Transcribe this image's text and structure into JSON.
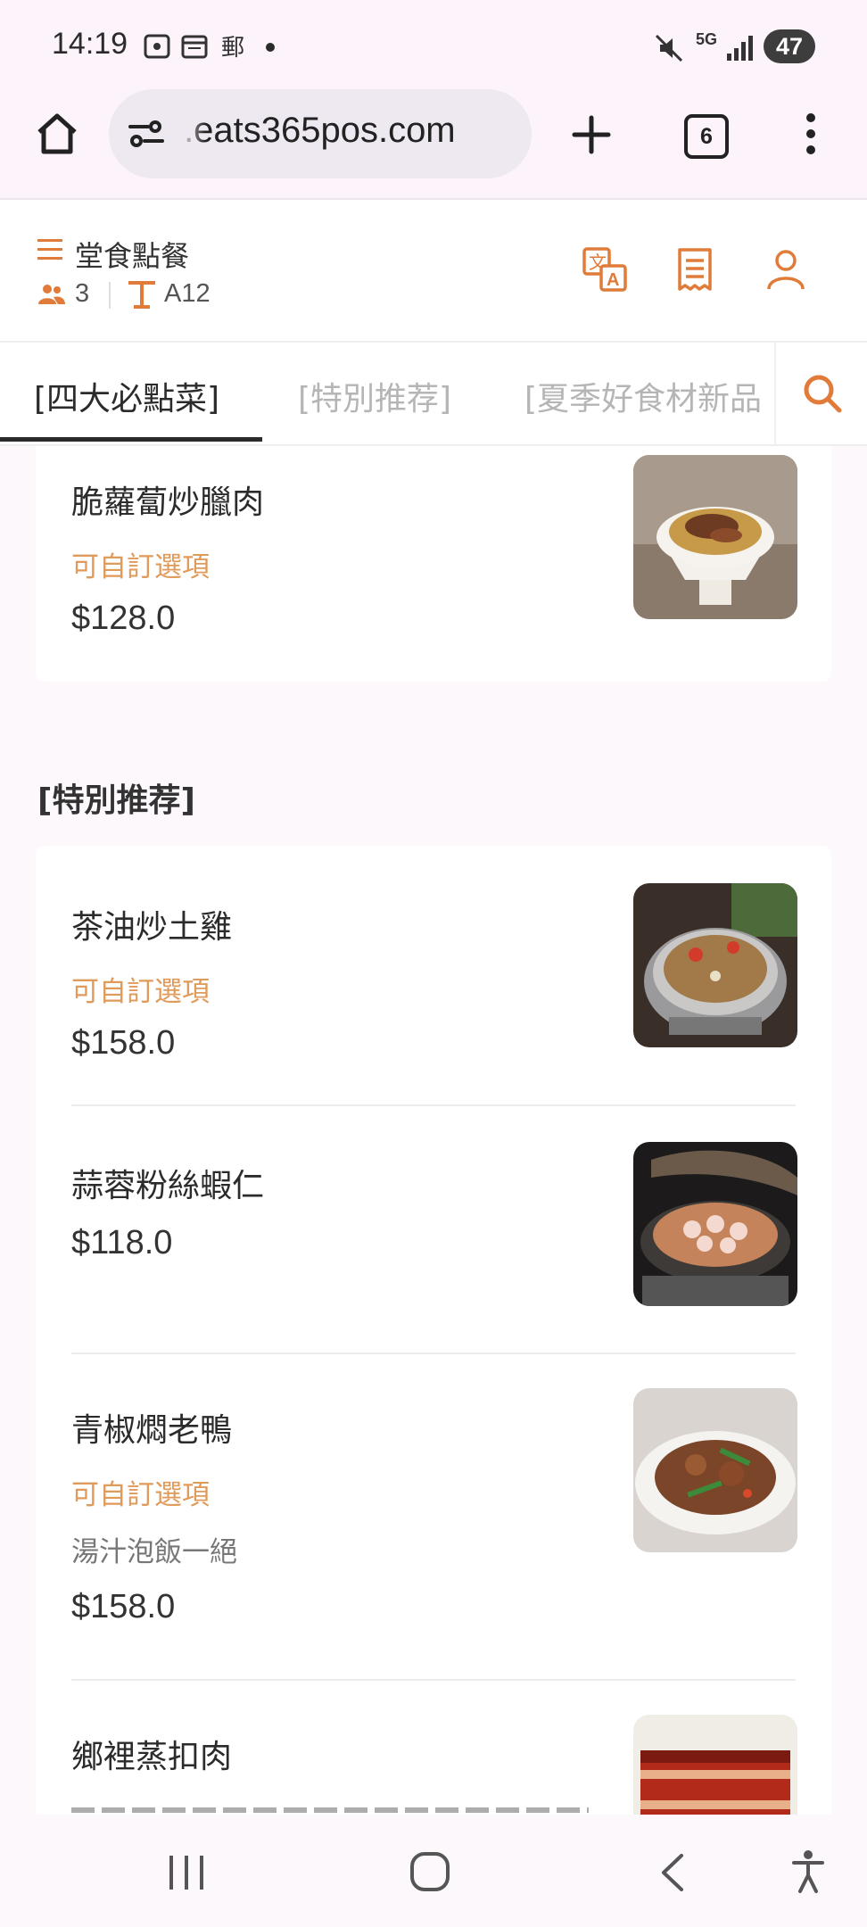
{
  "status_bar": {
    "time": "14:19",
    "network": "5G",
    "battery": "47"
  },
  "browser": {
    "url": ".eats365pos.com",
    "tab_count": "6"
  },
  "app_header": {
    "mode_title": "堂食點餐",
    "guest_count": "3",
    "table_number": "A12",
    "accent_color": "#e07b39"
  },
  "category_tabs": [
    {
      "label": "[四大必點菜]",
      "active": true
    },
    {
      "label": "[特別推荐]",
      "active": false
    },
    {
      "label": "[夏季好食材新品",
      "active": false
    }
  ],
  "menu": {
    "partial_item": {
      "name": "脆蘿蔔炒臘肉",
      "customizable": "可自訂選項",
      "price": "$128.0",
      "image_icon": "stir-fried-dish-photo"
    },
    "section": {
      "title": "[特別推荐]",
      "items": [
        {
          "name": "茶油炒土雞",
          "customizable": "可自訂選項",
          "desc": "",
          "price": "$158.0",
          "image_icon": "chicken-pot-photo"
        },
        {
          "name": "蒜蓉粉絲蝦仁",
          "customizable": "",
          "desc": "",
          "price": "$118.0",
          "image_icon": "shrimp-claypot-photo"
        },
        {
          "name": "青椒燜老鴨",
          "customizable": "可自訂選項",
          "desc": "湯汁泡飯一絕",
          "price": "$158.0",
          "image_icon": "duck-stew-photo"
        },
        {
          "name": "鄉裡蒸扣肉",
          "customizable": "",
          "desc": "",
          "price": "",
          "image_icon": "pork-belly-photo"
        }
      ]
    }
  }
}
